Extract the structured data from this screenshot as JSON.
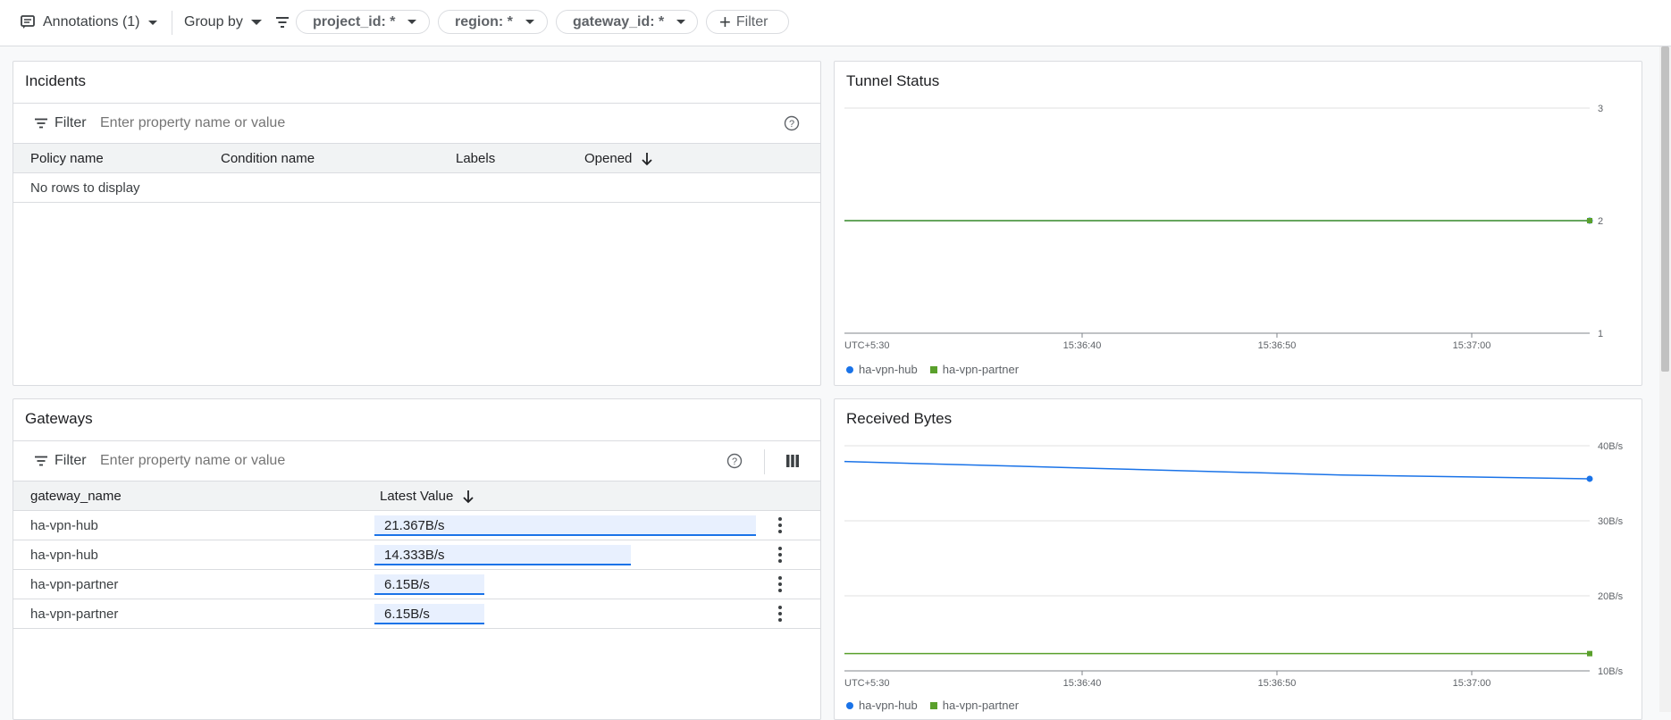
{
  "toolbar": {
    "annotations_label": "Annotations (1)",
    "group_by_label": "Group by",
    "filters": [
      "project_id: *",
      "region: *",
      "gateway_id: *"
    ],
    "add_filter_label": "Filter"
  },
  "incidents": {
    "title": "Incidents",
    "filter_label": "Filter",
    "filter_placeholder": "Enter property name or value",
    "columns": [
      "Policy name",
      "Condition name",
      "Labels",
      "Opened"
    ],
    "empty_text": "No rows to display"
  },
  "gateways": {
    "title": "Gateways",
    "filter_label": "Filter",
    "filter_placeholder": "Enter property name or value",
    "columns": [
      "gateway_name",
      "Latest Value"
    ],
    "rows": [
      {
        "name": "ha-vpn-hub",
        "value": "21.367B/s",
        "fraction": 1.0
      },
      {
        "name": "ha-vpn-hub",
        "value": "14.333B/s",
        "fraction": 0.671
      },
      {
        "name": "ha-vpn-partner",
        "value": "6.15B/s",
        "fraction": 0.288
      },
      {
        "name": "ha-vpn-partner",
        "value": "6.15B/s",
        "fraction": 0.288
      }
    ]
  },
  "tunnel_status": {
    "title": "Tunnel Status",
    "y_ticks": [
      "3",
      "2",
      "1"
    ],
    "x_ticks": [
      "UTC+5:30",
      "15:36:40",
      "15:36:50",
      "15:37:00"
    ],
    "legend": [
      "ha-vpn-hub",
      "ha-vpn-partner"
    ]
  },
  "received_bytes": {
    "title": "Received Bytes",
    "y_ticks": [
      "40B/s",
      "30B/s",
      "20B/s",
      "10B/s"
    ],
    "x_ticks": [
      "UTC+5:30",
      "15:36:40",
      "15:36:50",
      "15:37:00"
    ],
    "legend": [
      "ha-vpn-hub",
      "ha-vpn-partner"
    ]
  },
  "colors": {
    "series_hub": "#1a73e8",
    "series_partner": "#5aa02c",
    "bar_fill": "#e8f0fe"
  },
  "chart_data": [
    {
      "type": "line",
      "title": "Tunnel Status",
      "ylim": [
        1,
        3
      ],
      "y_ticks": [
        3,
        2,
        1
      ],
      "x": [
        "UTC+5:30",
        "15:36:40",
        "15:36:50",
        "15:37:00"
      ],
      "series": [
        {
          "name": "ha-vpn-hub",
          "color": "#1a73e8",
          "values": [
            2,
            2,
            2,
            2
          ]
        },
        {
          "name": "ha-vpn-partner",
          "color": "#5aa02c",
          "values": [
            2,
            2,
            2,
            2
          ]
        }
      ],
      "grid": true,
      "legend": "bottom-left"
    },
    {
      "type": "line",
      "title": "Received Bytes",
      "ylim": [
        10,
        40
      ],
      "y_ticks": [
        "40B/s",
        "30B/s",
        "20B/s",
        "10B/s"
      ],
      "x": [
        "UTC+5:30",
        "15:36:40",
        "15:36:50",
        "15:37:00"
      ],
      "series": [
        {
          "name": "ha-vpn-hub",
          "color": "#1a73e8",
          "values": [
            37.9,
            37.0,
            36.1,
            35.6
          ]
        },
        {
          "name": "ha-vpn-partner",
          "color": "#5aa02c",
          "values": [
            12.3,
            12.3,
            12.3,
            12.3
          ]
        }
      ],
      "grid": true,
      "legend": "bottom-left"
    }
  ]
}
